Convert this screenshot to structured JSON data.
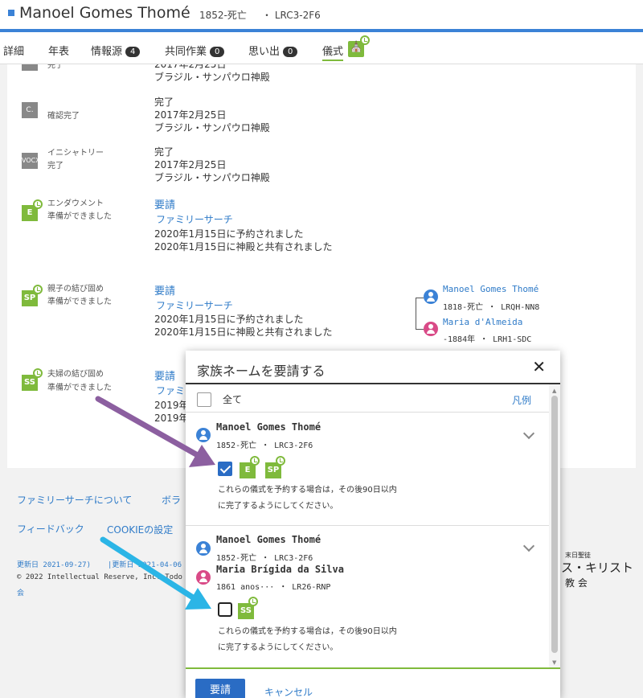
{
  "header": {
    "name": "Manoel Gomes Thomé",
    "lifespan": "1852-死亡",
    "pid": "・ LRC3-2F6"
  },
  "tabs": [
    {
      "label": "詳細"
    },
    {
      "label": "年表"
    },
    {
      "label": "情報源",
      "count": "4"
    },
    {
      "label": "共同作業",
      "count": "0"
    },
    {
      "label": "思い出",
      "count": "0"
    },
    {
      "label": "儀式"
    }
  ],
  "ordinances": {
    "baptism_partial": {
      "label": "完了",
      "line1": "2017年2月25日",
      "line2": "ブラジル・サンパウロ神殿"
    },
    "confirmation": {
      "icon": "C.",
      "label": "確認完了",
      "status": "完了",
      "date": "2017年2月25日",
      "temple": "ブラジル・サンパウロ神殿"
    },
    "initiatory": {
      "icon": "VOCX",
      "label1": "イニシャトリー",
      "label2": "完了",
      "status": "完了",
      "date": "2017年2月25日",
      "temple": "ブラジル・サンパウロ神殿"
    },
    "endowment": {
      "icon": "E",
      "label1": "エンダウメント",
      "label2": "準備ができました",
      "request": "要請",
      "org": "ファミリーサーチ",
      "reserved": "2020年1月15日に予約されました",
      "shared": "2020年1月15日に神殿と共有されました"
    },
    "sealing_parents": {
      "icon": "SP",
      "label1": "親子の結び固め",
      "label2": "準備ができました",
      "request": "要請",
      "org": "ファミリーサーチ",
      "reserved": "2020年1月15日に予約されました",
      "shared": "2020年1月15日に神殿と共有されました"
    },
    "sealing_spouse": {
      "icon": "SS",
      "label1": "夫婦の結び固め",
      "label2": "準備ができました",
      "request": "要請",
      "org": "ファミ",
      "line3": "2019年",
      "line4": "2019年"
    }
  },
  "parents": [
    {
      "name": "Manoel Gomes Thomé",
      "meta": "1818-死亡   ・ LRQH-NN8"
    },
    {
      "name": "Maria d'Almeida",
      "meta": "-1884年 ・ LRH1-SDC"
    }
  ],
  "footer": {
    "about": "ファミリーサーチについて",
    "about_cut": "ボラ",
    "feedback": "フィードバック",
    "cookie": "COOKIEの設定",
    "updated1": "更新日 2021-09-27)",
    "updated2": "|更新日 2021-04-06",
    "copyright": "© 2022 Intellectual Reserve, Inc. Todo",
    "copyright2": "会",
    "church_small": "末日聖徒",
    "church_main": "ス・キリスト",
    "church_sub": "教 会"
  },
  "modal": {
    "title": "家族ネームを要請する",
    "close": "✕",
    "select_all": "全て",
    "legend": "凡例",
    "entries": [
      {
        "name": "Manoel Gomes Thomé",
        "meta": "1852-死亡   ・ LRC3-2F6",
        "badges": [
          "E",
          "SP"
        ],
        "checked": true,
        "note1": "これらの儀式を予約する場合は，その後90日以内",
        "note2": "に完了するようにしてください。"
      },
      {
        "name": "Manoel Gomes Thomé",
        "meta": "1852-死亡   ・ LRC3-2F6",
        "spouse_name": "Maria Brígida da Silva",
        "spouse_meta": "1861 anos··· ・ LR26-RNP",
        "badges": [
          "SS"
        ],
        "checked": false,
        "note1": "これらの儀式を予約する場合は，その後90日以内",
        "note2": "に完了するようにしてください。"
      }
    ],
    "primary_button": "要請",
    "cancel_button": "キャンセル"
  },
  "colors": {
    "brand_blue": "#3b82d6",
    "ordinance_green": "#7fba3c",
    "arrow_purple": "#8c5fa0",
    "arrow_cyan": "#2bb5e6"
  }
}
